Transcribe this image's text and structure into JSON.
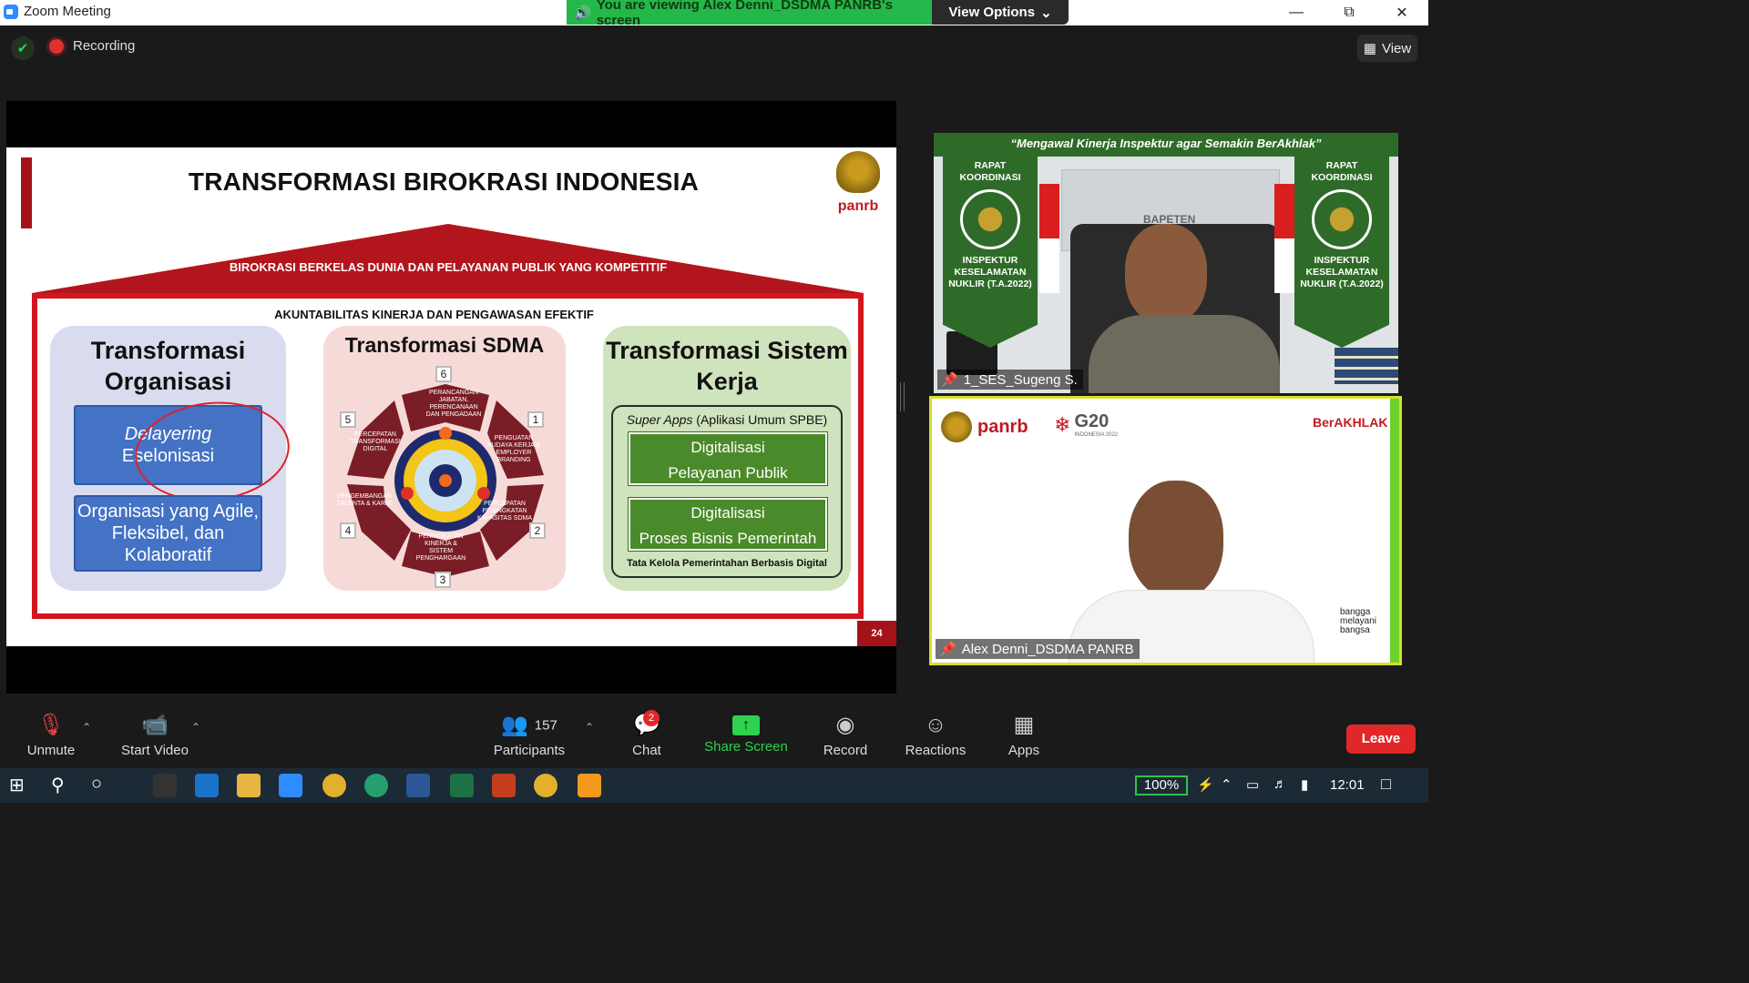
{
  "window": {
    "app_title": "Zoom Meeting",
    "viewing_banner": "You are viewing Alex Denni_DSDMA PANRB's screen",
    "view_options": "View Options",
    "minimize_icon": "minimize-icon",
    "maximize_icon": "restore-icon",
    "close_icon": "close-icon"
  },
  "meeting_bar": {
    "recording_label": "Recording",
    "view_label": "View"
  },
  "slide": {
    "title": "TRANSFORMASI BIROKRASI INDONESIA",
    "logo_text": "panrb",
    "roof_label": "BIROKRASI BERKELAS DUNIA DAN PELAYANAN PUBLIK YANG KOMPETITIF",
    "accountability_label": "AKUNTABILITAS KINERJA DAN PENGAWASAN EFEKTIF",
    "col1": {
      "title": "Transformasi Organisasi",
      "box1_line1": "Delayering",
      "box1_line2": "Eselonisasi",
      "box2": "Organisasi yang Agile, Fleksibel, dan Kolaboratif"
    },
    "col2": {
      "title": "Transformasi SDMA",
      "steps": [
        {
          "num": "1",
          "text": "PENGUATAN BUDAYA KERJA & EMPLOYER BRANDING"
        },
        {
          "num": "2",
          "text": "PERCEPATAN PENINGKATAN KAPASITAS SDMA"
        },
        {
          "num": "3",
          "text": "PENINGKATAN KINERJA & SISTEM PENGHARGAAN"
        },
        {
          "num": "4",
          "text": "PENGEMBANGAN TALENTA & KARIR"
        },
        {
          "num": "5",
          "text": "PERCEPATAN TRANSFORMASI DIGITAL"
        },
        {
          "num": "6",
          "text": "PERANCANGAN JABATAN, PERENCANAAN DAN PENGADAAN"
        }
      ]
    },
    "col3": {
      "title": "Transformasi Sistem Kerja",
      "super_apps_italic": "Super Apps",
      "super_apps_rest": " (Aplikasi Umum SPBE)",
      "box1_line1": "Digitalisasi",
      "box1_line2": "Pelayanan Publik",
      "box2_line1": "Digitalisasi",
      "box2_line2": "Proses Bisnis Pemerintah",
      "footer": "Tata Kelola Pemerintahan Berbasis Digital"
    },
    "page_number": "24"
  },
  "participants": [
    {
      "name": "1_SES_Sugeng S.",
      "banner": "“Mengawal Kinerja Inspektur agar Semakin BerAkhlak”",
      "pennant_top": "RAPAT KOORDINASI",
      "pennant_bottom": "INSPEKTUR KESELAMATAN NUKLIR (T.A.2022)",
      "building_label": "BAPETEN"
    },
    {
      "name": "Alex Denni_DSDMA PANRB",
      "logo_panrb": "panrb",
      "logo_g20": "G20",
      "logo_g20_sub": "INDONESIA 2022",
      "logo_berakhlak": "BerAKHLAK",
      "bangga": "bangga melayani bangsa"
    }
  ],
  "toolbar": {
    "unmute": "Unmute",
    "start_video": "Start Video",
    "participants_count": "157",
    "participants": "Participants",
    "chat": "Chat",
    "chat_badge": "2",
    "share_screen": "Share Screen",
    "record": "Record",
    "reactions": "Reactions",
    "apps": "Apps",
    "leave": "Leave"
  },
  "taskbar": {
    "battery": "100%",
    "time": "12:01"
  },
  "colors": {
    "slide_red": "#d2161e",
    "zoom_green": "#24b84a",
    "leave_red": "#e02828",
    "active_speaker": "#d6e02a"
  }
}
